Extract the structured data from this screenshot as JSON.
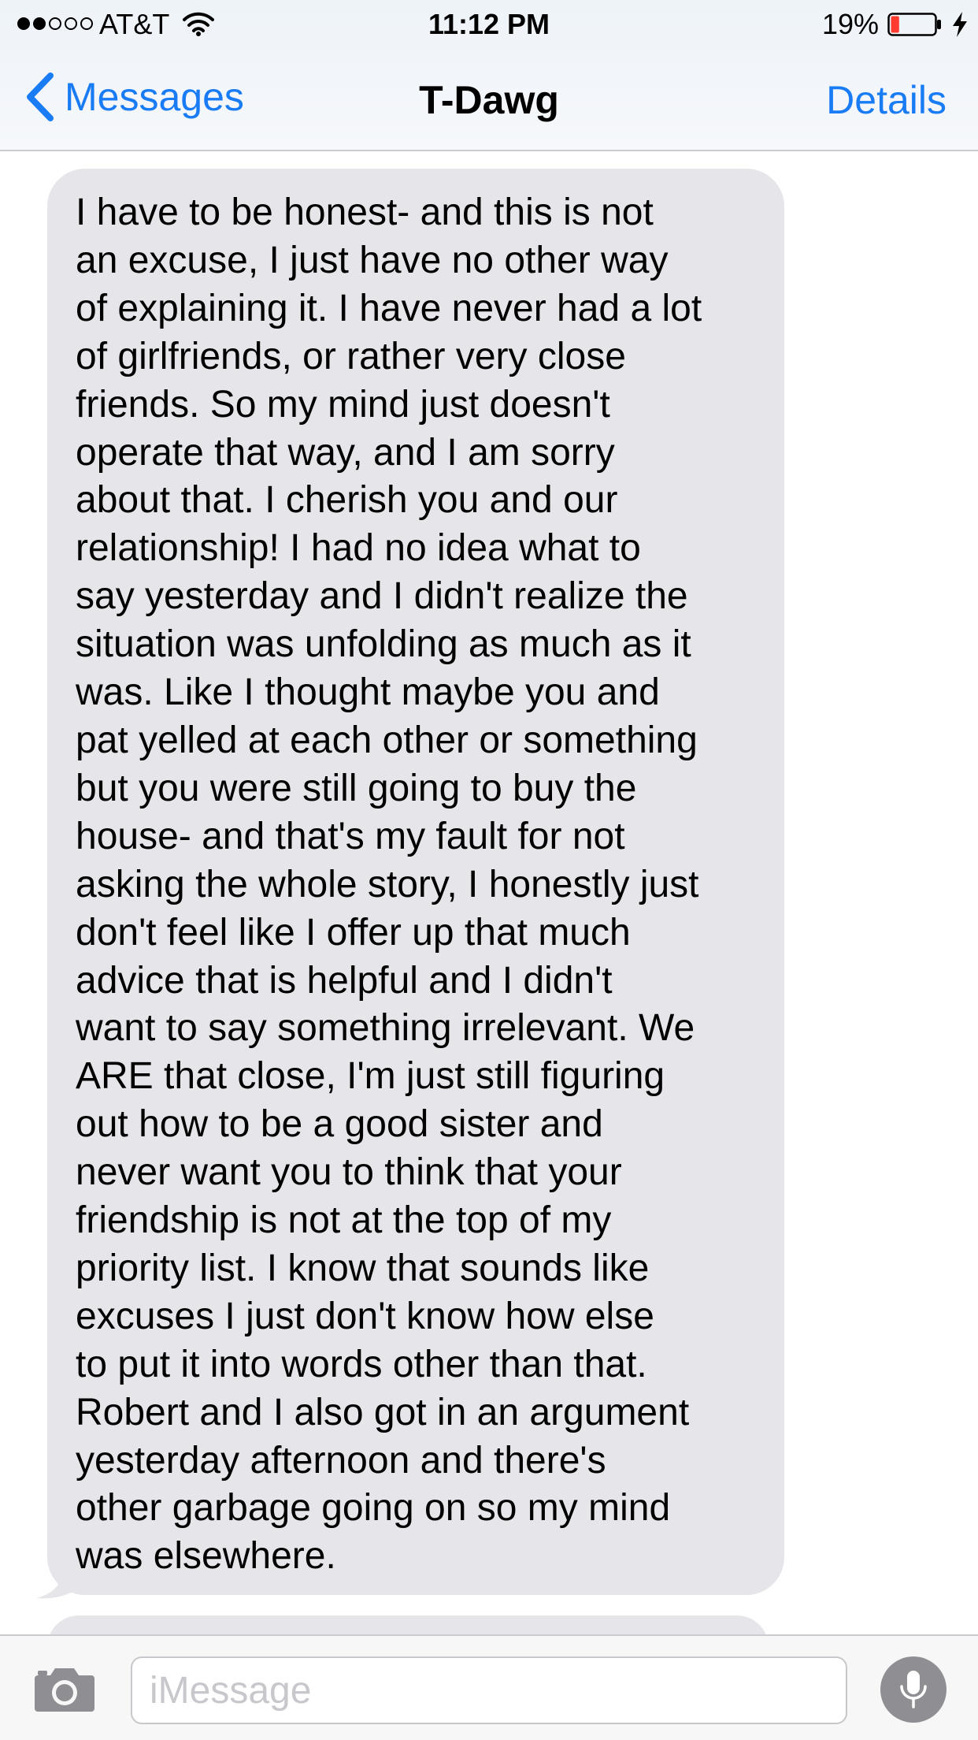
{
  "status_bar": {
    "carrier": "AT&T",
    "signal_bars_filled": 2,
    "signal_bars_total": 5,
    "time": "11:12 PM",
    "battery_percent": "19%",
    "battery_level": 0.19,
    "icons": [
      "wifi-icon",
      "battery-icon",
      "charging-bolt-icon"
    ]
  },
  "nav": {
    "back_label": "Messages",
    "title": "T-Dawg",
    "details_label": "Details",
    "accent_color": "#1a7cf5"
  },
  "conversation": {
    "messages": [
      {
        "direction": "incoming",
        "bubble_color": "#e5e5ea",
        "lines": [
          "I have to be honest- and this is not",
          "an excuse, I just have no other way",
          "of explaining it. I have never had a lot",
          "of girlfriends, or rather very close",
          "friends. So my mind just doesn't",
          "operate that way, and I am sorry",
          "about that. I cherish you and our",
          "relationship! I had no idea what to",
          "say yesterday and I didn't realize the",
          "situation was unfolding as much as it",
          "was. Like I thought maybe you and",
          "pat yelled at each other or something",
          "but you were still going to buy the",
          "house- and that's my fault for not",
          "asking the whole story, I honestly just",
          "don't feel like I offer up that much",
          "advice that is helpful and I didn't",
          "want to say something irrelevant. We",
          "ARE that close, I'm just still figuring",
          "out how to be a good sister and",
          "never want you to think that your",
          "friendship is not at the top of my",
          "priority list. I know that sounds like",
          "excuses I just don't know how else",
          "to put it into words other than that.",
          "Robert and I also got in an argument",
          "yesterday afternoon and there's",
          "other garbage going on so my mind",
          "was elsewhere."
        ]
      }
    ]
  },
  "input_bar": {
    "placeholder": "iMessage",
    "value": "",
    "icons": [
      "camera-icon",
      "microphone-icon"
    ]
  }
}
